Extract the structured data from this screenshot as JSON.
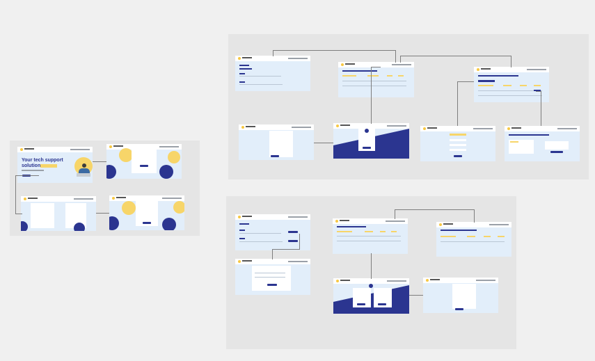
{
  "colors": {
    "canvas": "#f0f0f0",
    "group_bg": "#e5e5e5",
    "screen_bg": "#e2eefa",
    "navy": "#2b3590",
    "yellow": "#f7d569",
    "connector": "#7d7d7d"
  },
  "landing": {
    "headline_line1": "Your tech support",
    "headline_line2": "solution"
  },
  "icons": {
    "logo": "logo-mark-icon",
    "avatar": "person-avatar-icon",
    "user": "user-circle-icon"
  }
}
